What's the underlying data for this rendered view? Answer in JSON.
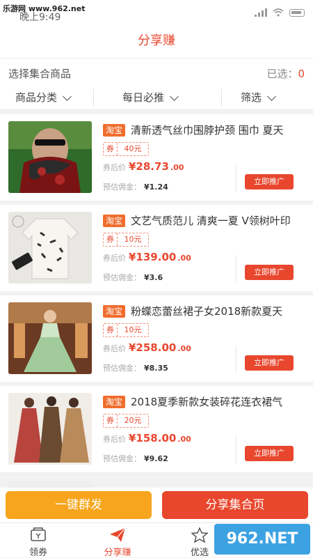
{
  "status": {
    "watermark": "乐游网 www.962.net",
    "time": "晚上9:49"
  },
  "header": {
    "title": "分享赚"
  },
  "selection": {
    "label": "选择集合商品",
    "selected_label": "已选：",
    "selected_count": "0"
  },
  "filters": [
    {
      "label": "商品分类"
    },
    {
      "label": "每日必推"
    },
    {
      "label": "筛选"
    }
  ],
  "products": [
    {
      "source": "淘宝",
      "title": "清新透气丝巾围脖护颈 围巾 夏天",
      "coupon_label": "券",
      "coupon": "40元",
      "price_label": "券后价",
      "price": "¥28.73",
      "price_dec": ".00",
      "commission_label": "预估佣金：",
      "commission": "¥1.24",
      "button": "立即推广"
    },
    {
      "source": "淘宝",
      "title": "文艺气质范儿 清爽一夏 V领树叶印",
      "coupon_label": "券",
      "coupon": "10元",
      "price_label": "券后价",
      "price": "¥139.00",
      "price_dec": ".00",
      "commission_label": "预估佣金：",
      "commission": "¥3.6",
      "button": "立即推广"
    },
    {
      "source": "淘宝",
      "title": "粉蝶恋蕾丝裙子女2018新款夏天",
      "coupon_label": "券",
      "coupon": "10元",
      "price_label": "券后价",
      "price": "¥258.00",
      "price_dec": ".00",
      "commission_label": "预估佣金：",
      "commission": "¥8.35",
      "button": "立即推广"
    },
    {
      "source": "淘宝",
      "title": "2018夏季新款女装碎花连衣裙气",
      "coupon_label": "券",
      "coupon": "20元",
      "price_label": "券后价",
      "price": "¥158.00",
      "price_dec": ".00",
      "commission_label": "预估佣金：",
      "commission": "¥9.62",
      "button": "立即推广"
    }
  ],
  "actions": {
    "bulk_send": "一键群发",
    "share_page": "分享集合页"
  },
  "tabs": [
    {
      "label": "领券",
      "icon": "coupon-icon"
    },
    {
      "label": "分享赚",
      "icon": "paper-plane-icon"
    },
    {
      "label": "优选",
      "icon": "star-icon"
    }
  ],
  "logo": {
    "text": "962.NET",
    "sub": "乐游网"
  },
  "colors": {
    "accent": "#e8472e",
    "orange": "#f7a51c",
    "tag": "#f06d2e"
  }
}
